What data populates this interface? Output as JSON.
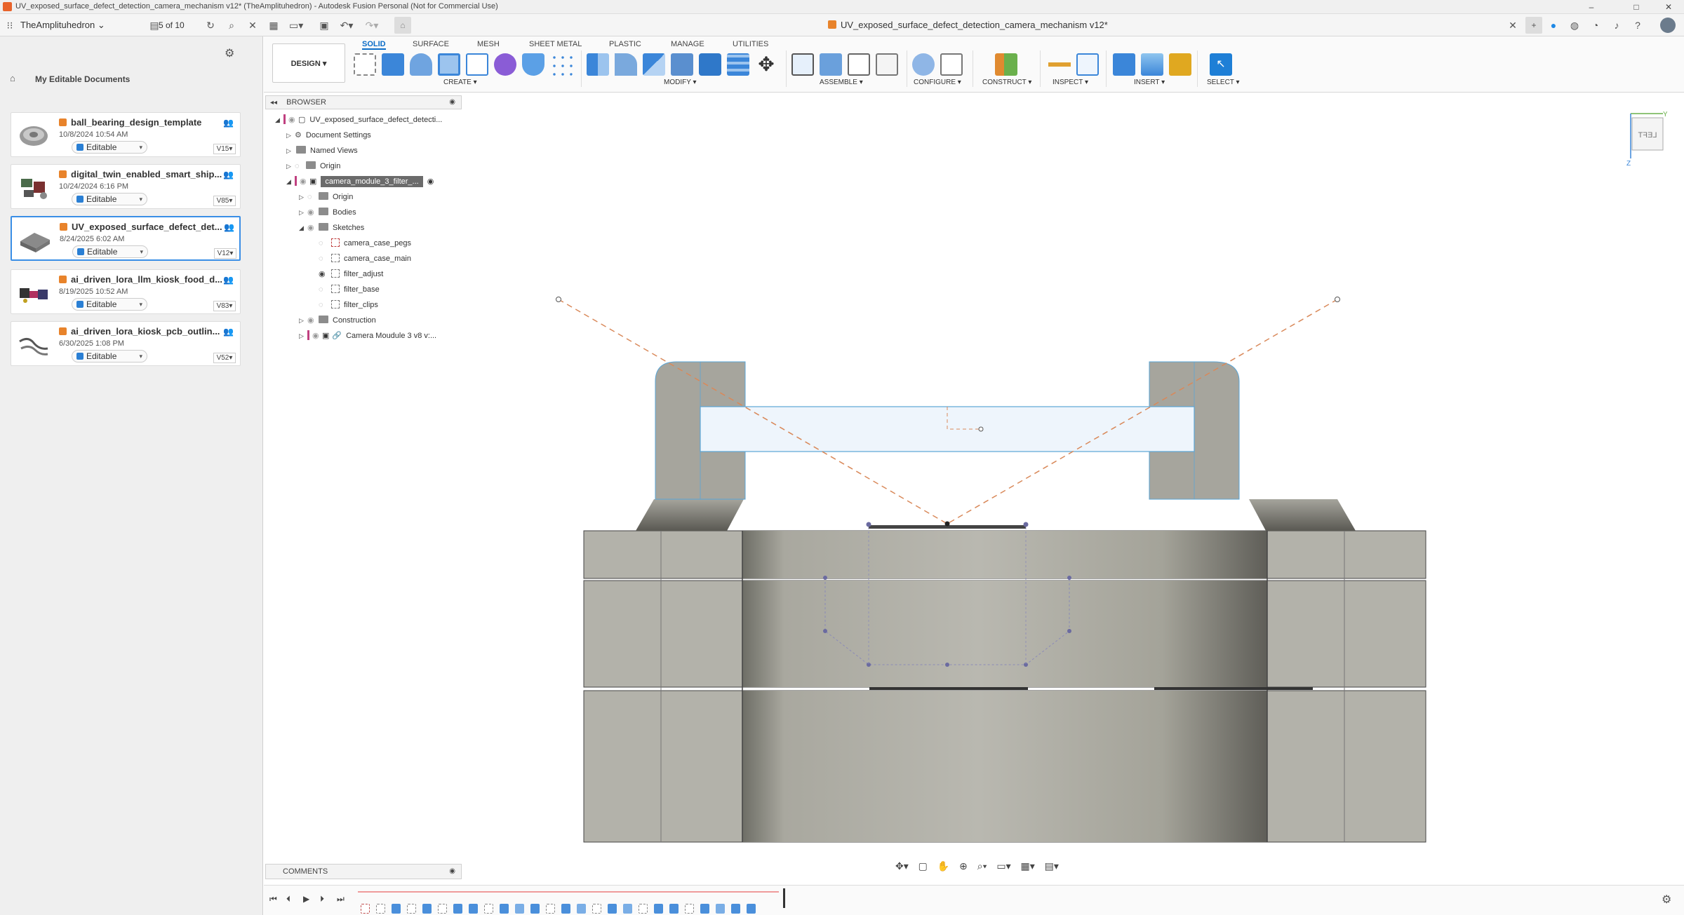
{
  "window": {
    "title": "UV_exposed_surface_defect_detection_camera_mechanism v12* (TheAmplituhedron) - Autodesk Fusion Personal (Not for Commercial Use)",
    "controls": [
      "–",
      "□",
      "✕"
    ]
  },
  "appbar": {
    "team": "TheAmplituhedron",
    "version_counter": "5 of 10",
    "document_tab": "UV_exposed_surface_defect_detection_camera_mechanism v12*"
  },
  "data_panel": {
    "breadcrumb": "My Editable Documents",
    "documents": [
      {
        "name": "ball_bearing_design_template",
        "date": "10/8/2024 10:54 AM",
        "status": "Editable",
        "version": "V15"
      },
      {
        "name": "digital_twin_enabled_smart_ship...",
        "date": "10/24/2024 6:16 PM",
        "status": "Editable",
        "version": "V85"
      },
      {
        "name": "UV_exposed_surface_defect_det...",
        "date": "8/24/2025 6:02 AM",
        "status": "Editable",
        "version": "V12"
      },
      {
        "name": "ai_driven_lora_llm_kiosk_food_d...",
        "date": "8/19/2025 10:52 AM",
        "status": "Editable",
        "version": "V83"
      },
      {
        "name": "ai_driven_lora_kiosk_pcb_outlin...",
        "date": "6/30/2025 1:08 PM",
        "status": "Editable",
        "version": "V52"
      }
    ]
  },
  "toolbar": {
    "workspace": "DESIGN ▾",
    "tabs": [
      "SOLID",
      "SURFACE",
      "MESH",
      "SHEET METAL",
      "PLASTIC",
      "MANAGE",
      "UTILITIES"
    ],
    "groups": [
      "CREATE ▾",
      "MODIFY ▾",
      "ASSEMBLE ▾",
      "CONFIGURE ▾",
      "CONSTRUCT ▾",
      "INSPECT ▾",
      "INSERT ▾",
      "SELECT ▾"
    ]
  },
  "browser": {
    "title": "BROWSER",
    "root": "UV_exposed_surface_defect_detecti...",
    "items": [
      {
        "label": "Document Settings"
      },
      {
        "label": "Named Views"
      },
      {
        "label": "Origin"
      },
      {
        "label": "camera_module_3_filter_..."
      },
      {
        "label": "Origin"
      },
      {
        "label": "Bodies"
      },
      {
        "label": "Sketches"
      },
      {
        "label": "camera_case_pegs"
      },
      {
        "label": "camera_case_main"
      },
      {
        "label": "filter_adjust"
      },
      {
        "label": "filter_base"
      },
      {
        "label": "filter_clips"
      },
      {
        "label": "Construction"
      },
      {
        "label": "Camera Moudule 3 v8 v:..."
      }
    ]
  },
  "comments": {
    "title": "COMMENTS"
  },
  "viewcube": {
    "face": "LEFT",
    "axis_y": "Y",
    "axis_z": "Z"
  }
}
